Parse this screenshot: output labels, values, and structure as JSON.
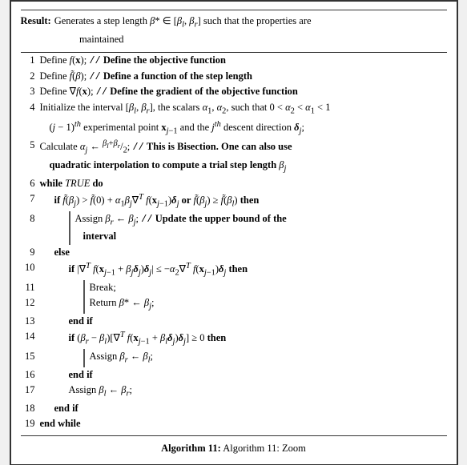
{
  "algorithm": {
    "title": "Algorithm 11: Zoom",
    "result_label": "Result:",
    "result_text": "Generates a step length β* ∈ [β_l, β_r] such that the properties are maintained",
    "lines": [
      {
        "num": "1",
        "text": "Define f(x); // Define the objective function"
      },
      {
        "num": "2",
        "text": "Define f̃(β); // Define a function of the step length"
      },
      {
        "num": "3",
        "text": "Define ∇f(x); // Define the gradient of the objective function"
      },
      {
        "num": "4",
        "text": "Initialize the interval [β_l, β_r], the scalars α₁, α₂, such that 0 < α₂ < α₁ < 1 (j−1)^th experimental point x_{j−1} and the j^th descent direction δ_j;"
      },
      {
        "num": "5",
        "text": "Calculate α_j ← (β_l+β_r)/2; // This is Bisection. One can also use quadratic interpolation to compute a trial step length β_j"
      },
      {
        "num": "6",
        "text": "while TRUE do"
      },
      {
        "num": "7",
        "text": "if f̃(β_j) > f̃(0) + α₁β_j∇^T f(x_{j−1})δ_j or f̃(β_j) ≥ f̃(β_l) then"
      },
      {
        "num": "8",
        "text": "Assign β_r ← β_j; // Update the upper bound of the interval"
      },
      {
        "num": "9",
        "text": "else"
      },
      {
        "num": "10",
        "text": "if |∇^T f(x_{j−1} + β_jδ_j)δ_j| ≤ −α₂∇^T f(x_{j−1})δ_j then"
      },
      {
        "num": "11",
        "text": "Break;"
      },
      {
        "num": "12",
        "text": "Return β* ← β_j;"
      },
      {
        "num": "13",
        "text": "end if"
      },
      {
        "num": "14",
        "text": "if (β_r − β_l)[∇^T f(x_{j−1} + β_lδ_j)δ_j] ≥ 0 then"
      },
      {
        "num": "15",
        "text": "Assign β_r ← β_l;"
      },
      {
        "num": "16",
        "text": "end if"
      },
      {
        "num": "17",
        "text": "Assign β_l ← β_r;"
      },
      {
        "num": "18",
        "text": "end if"
      },
      {
        "num": "19",
        "text": "end while"
      }
    ]
  }
}
